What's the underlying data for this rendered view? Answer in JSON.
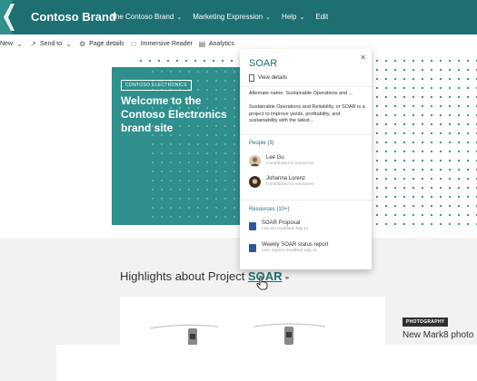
{
  "suite": {
    "brand": "Contoso Brand",
    "nav": [
      {
        "label": "The Contoso Brand",
        "has_chevron": true
      },
      {
        "label": "Marketing Expression",
        "has_chevron": true
      },
      {
        "label": "Help",
        "has_chevron": true
      },
      {
        "label": "Edit",
        "has_chevron": false
      }
    ]
  },
  "commandbar": {
    "items": [
      {
        "label": "New",
        "icon": "chevron-down-icon"
      },
      {
        "label": "Send to",
        "icon": "share-icon"
      },
      {
        "label": "Page details",
        "icon": "gear-icon"
      },
      {
        "label": "Immersive Reader",
        "icon": "reader-icon"
      },
      {
        "label": "Analytics",
        "icon": "chart-icon"
      }
    ]
  },
  "hero": {
    "badge": "CONTOSO ELECTRONICS",
    "title": "Welcome to the Contoso Electronics brand site"
  },
  "highlights": {
    "prefix": "Highlights about Project ",
    "link": "SOAR"
  },
  "news": {
    "tag": "PHOTOGRAPHY",
    "title": "New Mark8 photo"
  },
  "hovercard": {
    "title": "SOAR",
    "view_details": "View details",
    "alt_name": "Alternate name: Sustainable Operations and ...",
    "description": "Sustainable Operations and Reliability, or SOAR is a project to improve yields, profitability, and sustainability with the latest...",
    "people_header": "People (3)",
    "people": [
      {
        "name": "Lee Gu",
        "sub": "Contributed to resources"
      },
      {
        "name": "Johanna Lorenz",
        "sub": "Contributed to resources"
      }
    ],
    "resources_header": "Resources (10+)",
    "resources": [
      {
        "name": "SOAR Proposal",
        "sub": "Lee Gu modified July 11"
      },
      {
        "name": "Weekly SOAR status report",
        "sub": "Irvin Sayers modified July 11"
      }
    ]
  },
  "colors": {
    "brand": "#1d6f72",
    "hero": "#2f8f8c",
    "word_blue": "#2b579a"
  }
}
